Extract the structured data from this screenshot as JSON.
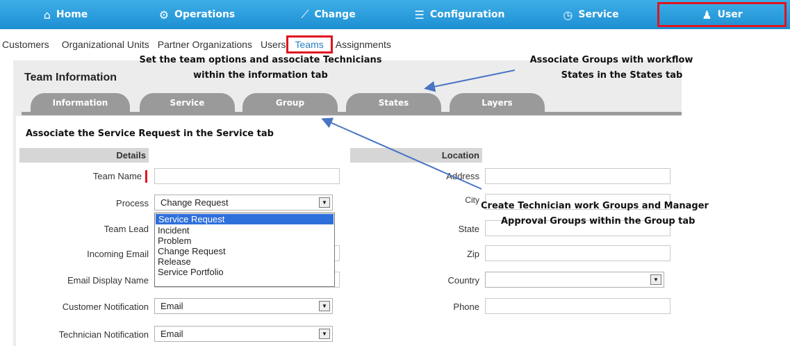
{
  "nav": {
    "items": [
      {
        "icon": "⌂",
        "label": "Home"
      },
      {
        "icon": "⚙",
        "label": "Operations"
      },
      {
        "icon": "⟋",
        "label": "Change"
      },
      {
        "icon": "☰",
        "label": "Configuration"
      },
      {
        "icon": "◷",
        "label": "Service"
      },
      {
        "icon": "♟",
        "label": "User"
      }
    ]
  },
  "subnav": {
    "items": [
      "Customers",
      "Organizational Units",
      "Partner Organizations",
      "Users",
      "Teams",
      "Assignments"
    ]
  },
  "panel": {
    "title": "Team Information"
  },
  "tabs": [
    "Information",
    "Service",
    "Group",
    "States",
    "Layers"
  ],
  "details": {
    "header": "Details",
    "team_name_label": "Team Name",
    "process_label": "Process",
    "process_value": "Change Request",
    "team_lead_label": "Team Lead",
    "incoming_email_label": "Incoming Email",
    "email_display_name_label": "Email Display Name",
    "customer_notification_label": "Customer Notification",
    "customer_notification_value": "Email",
    "technician_notification_label": "Technician Notification",
    "technician_notification_value": "Email"
  },
  "dropdown": {
    "options": [
      "Service Request",
      "Incident",
      "Problem",
      "Change Request",
      "Release",
      "Service Portfolio"
    ]
  },
  "location": {
    "header": "Location",
    "address_label": "Address",
    "city_label": "City",
    "state_label": "State",
    "zip_label": "Zip",
    "country_label": "Country",
    "phone_label": "Phone"
  },
  "annotations": {
    "info_tab_line1": "Set the team options and associate Technicians",
    "info_tab_line2": "within the information tab",
    "states_tab_line1": "Associate Groups with workflow",
    "states_tab_line2": "States in the States tab",
    "service_tab": "Associate the Service Request in the Service tab",
    "group_tab_line1": "Create Technician work Groups and Manager",
    "group_tab_line2": "Approval Groups within the Group tab"
  },
  "colors": {
    "nav_bg": "#2a9ee0",
    "highlight_box": "#e0141e",
    "tab_bg": "#9a9a9a",
    "arrow": "#4a74c4",
    "dropdown_selected": "#2f6fdc"
  }
}
